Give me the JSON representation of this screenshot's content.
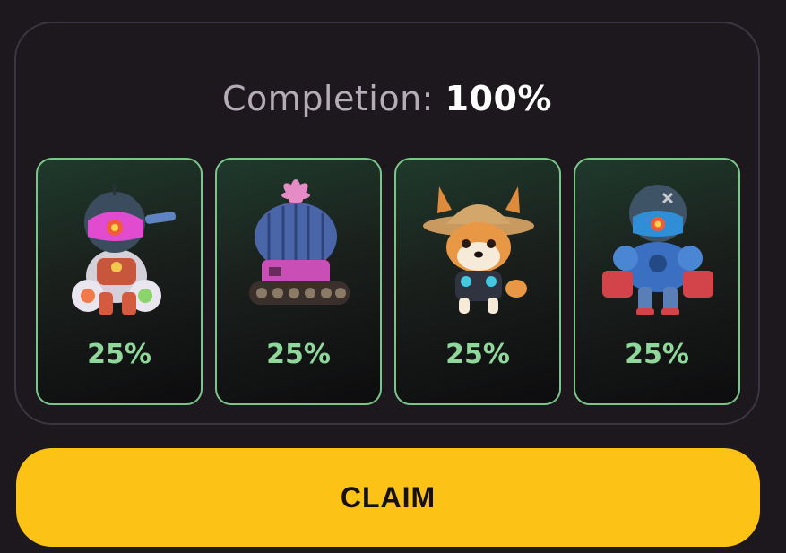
{
  "completion": {
    "label": "Completion:",
    "value": "100%"
  },
  "cards": [
    {
      "character": "astronaut-robot-icon",
      "percent": "25%"
    },
    {
      "character": "cactus-tank-icon",
      "percent": "25%"
    },
    {
      "character": "shiba-dog-straw-hat-icon",
      "percent": "25%"
    },
    {
      "character": "blue-armored-robot-icon",
      "percent": "25%"
    }
  ],
  "claim_button": {
    "label": "CLAIM"
  },
  "colors": {
    "accent_green": "#8fd79a",
    "card_border": "#7cc48a",
    "claim_yellow": "#fcc316",
    "background": "#1c181d"
  }
}
